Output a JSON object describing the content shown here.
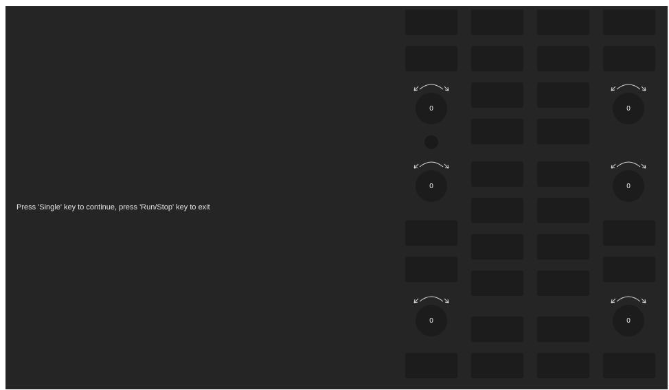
{
  "screen": {
    "message": "Press 'Single' key to continue, press 'Run/Stop' key to exit"
  },
  "knobs": [
    {
      "id": "top-left",
      "value": "0"
    },
    {
      "id": "top-right",
      "value": "0"
    },
    {
      "id": "middle-left",
      "value": "0"
    },
    {
      "id": "middle-right",
      "value": "0"
    },
    {
      "id": "bottom-left",
      "value": "0"
    },
    {
      "id": "bottom-right",
      "value": "0"
    }
  ],
  "colors": {
    "screen_background": "#252525",
    "key_background": "#1c1c1c",
    "text": "#e6e6e6"
  }
}
